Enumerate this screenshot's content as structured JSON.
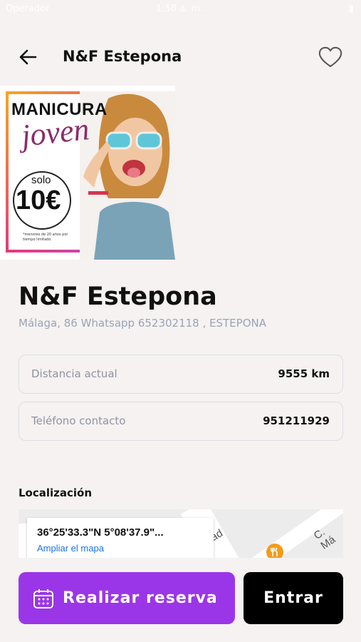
{
  "status_bar": {
    "carrier": "Operador",
    "time": "1:58 a. m.",
    "battery": "▮"
  },
  "header": {
    "title": "N&F Estepona",
    "back_icon": "arrow-left-icon",
    "favorite_icon": "heart-outline-icon"
  },
  "promo": {
    "title": "MANICURA",
    "script": "joven",
    "solo": "solo",
    "price": "10€",
    "note": "*menores de 20 años por tiempo limitado"
  },
  "business": {
    "name": "N&F Estepona",
    "address": "Málaga, 86 Whatsapp 652302118 , ESTEPONA"
  },
  "info": {
    "distance_label": "Distancia actual",
    "distance_value": "9555 km",
    "phone_label": "Teléfono contacto",
    "phone_value": "951211929"
  },
  "location": {
    "title": "Localización",
    "coords": "36°25'33.3\"N 5°08'37.9\"...",
    "map_link": "Ampliar el mapa",
    "street_label_1": "C. Má",
    "street_label_2": "ad",
    "poi_icon": "restaurant-icon"
  },
  "actions": {
    "reserve_label": "Realizar reserva",
    "reserve_icon": "calendar-icon",
    "enter_label": "Entrar"
  },
  "colors": {
    "accent": "#9b36e8",
    "background": "#f5f2f1",
    "muted_text": "#9aa4b8",
    "link": "#1a73e8"
  }
}
